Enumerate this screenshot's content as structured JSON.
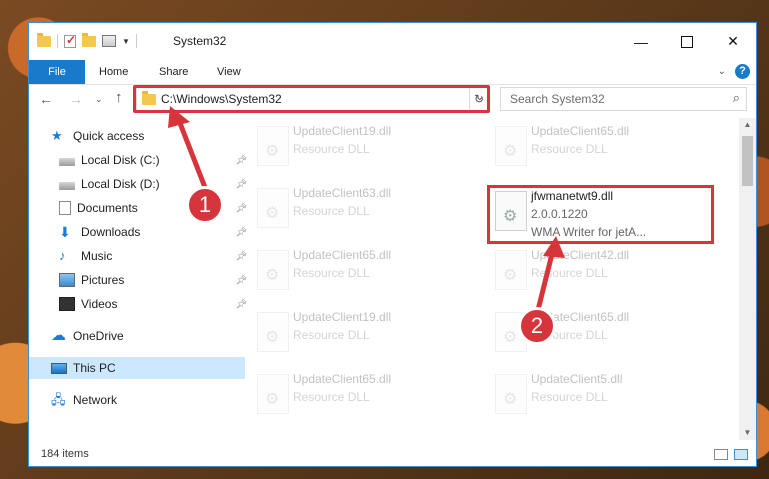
{
  "window": {
    "title": "System32"
  },
  "ribbon": {
    "file": "File",
    "home": "Home",
    "share": "Share",
    "view": "View"
  },
  "address": {
    "path": "C:\\Windows\\System32"
  },
  "search": {
    "placeholder": "Search System32"
  },
  "nav": {
    "quick_access": "Quick access",
    "local_c": "Local Disk (C:)",
    "local_d": "Local Disk (D:)",
    "documents": "Documents",
    "downloads": "Downloads",
    "music": "Music",
    "pictures": "Pictures",
    "videos": "Videos",
    "onedrive": "OneDrive",
    "this_pc": "This PC",
    "network": "Network"
  },
  "files": [
    {
      "name": "UpdateClient19.dll",
      "desc": "Resource DLL"
    },
    {
      "name": "UpdateClient65.dll",
      "desc": "Resource DLL"
    },
    {
      "name": "UpdateClient63.dll",
      "desc": "Resource DLL"
    },
    {
      "name": "jfwmanetwt9.dll",
      "version": "2.0.0.1220",
      "desc": "WMA Writer for jetA..."
    },
    {
      "name": "UpdateClient65.dll",
      "desc": "Resource DLL"
    },
    {
      "name": "UpdateClient42.dll",
      "desc": "Resource DLL"
    },
    {
      "name": "UpdateClient19.dll",
      "desc": "Resource DLL"
    },
    {
      "name": "UpdateClient65.dll",
      "desc": "Resource DLL"
    },
    {
      "name": "UpdateClient65.dll",
      "desc": "Resource DLL"
    },
    {
      "name": "UpdateClient5.dll",
      "desc": "Resource DLL"
    }
  ],
  "status": {
    "item_count": "184 items"
  },
  "markers": {
    "one": "1",
    "two": "2"
  },
  "colors": {
    "accent": "#1979ca",
    "highlight": "#d6363b",
    "selected": "#cce8ff"
  }
}
